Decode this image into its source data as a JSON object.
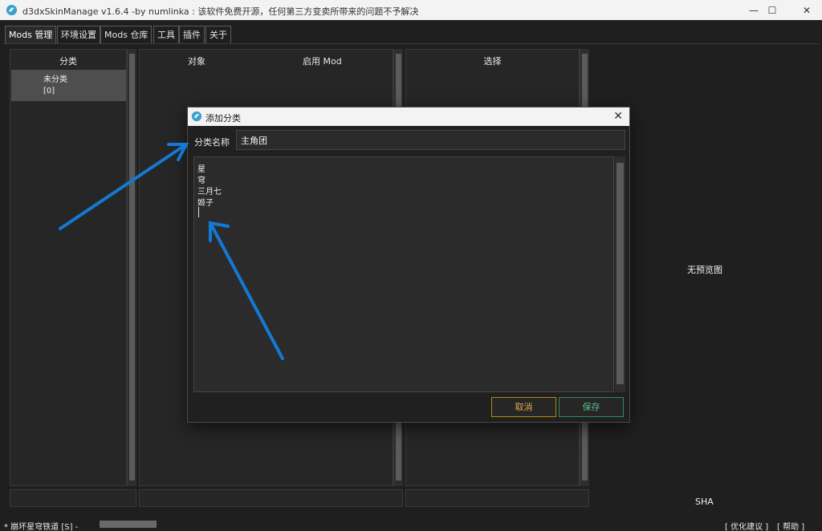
{
  "window": {
    "title": "d3dxSkinManage v1.6.4 -by numlinka : 该软件免费开源，任何第三方变卖所带来的问题不予解决",
    "minimize_glyph": "—",
    "maximize_glyph": "☐",
    "close_glyph": "✕"
  },
  "tabs": [
    "Mods 管理",
    "环境设置",
    "Mods 仓库",
    "工具",
    "插件",
    "关于"
  ],
  "panels": {
    "category_header": "分类",
    "object_header": "对象",
    "enabled_mod_header": "启用 Mod",
    "select_header": "选择"
  },
  "categories": [
    {
      "name": "未分类",
      "count": "[0]"
    }
  ],
  "preview": {
    "empty_text": "无预览图",
    "sha_label": "SHA"
  },
  "status": {
    "game": "* 崩坏星穹铁道    [S]    -",
    "suggest_link": "[ 优化建议 ]",
    "help_link": "[ 帮助 ]"
  },
  "dialog": {
    "title": "添加分类",
    "close_glyph": "✕",
    "name_label": "分类名称",
    "name_value": "主角团",
    "lines": [
      "星",
      "穹",
      "三月七",
      "姬子"
    ],
    "cancel_label": "取消",
    "save_label": "保存"
  },
  "colors": {
    "background": "#1f1f1f",
    "panel": "#262626",
    "selected_item": "#4e4e4e",
    "cancel_accent": "#e0a84a",
    "save_accent": "#57c08a",
    "annotation_arrow": "#1479d4"
  },
  "icons": {
    "app": "app-logo-icon",
    "arrow_annotation": "arrow-annotation"
  }
}
